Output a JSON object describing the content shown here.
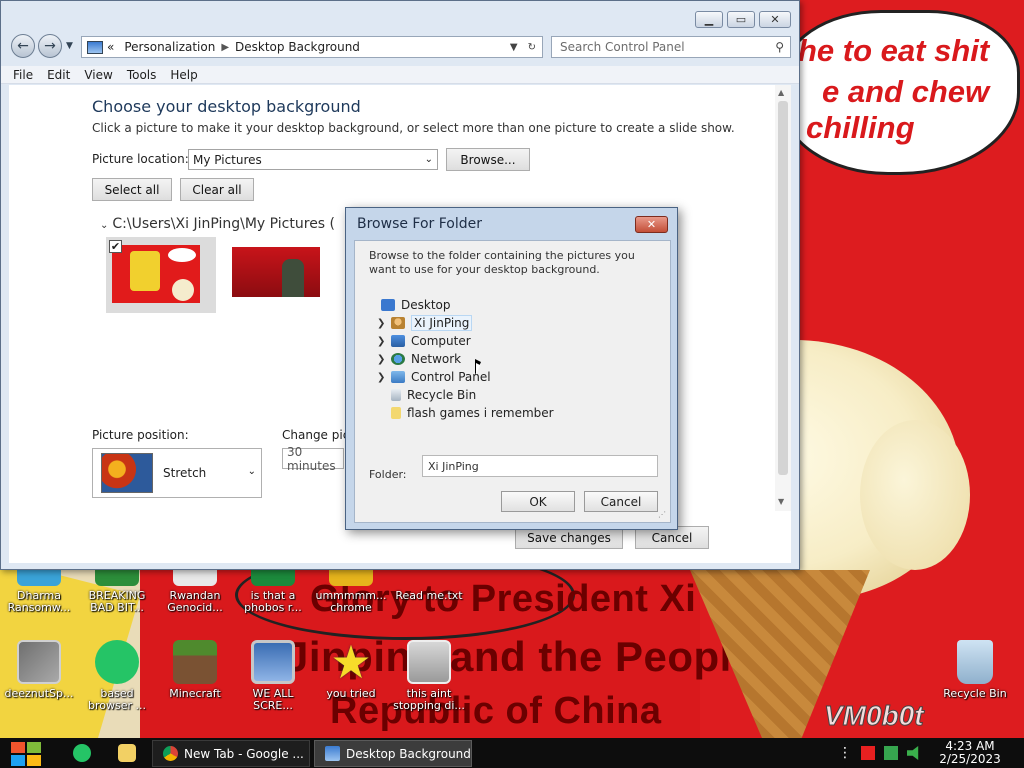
{
  "wallpaper": {
    "speech_lines": [
      "he to eat shit",
      "e and chew",
      "chilling"
    ],
    "slogan_lines": [
      "Glory to President Xi",
      "Jinping and the People's",
      "Republic of China"
    ],
    "watermark": "VM0b0t"
  },
  "desktop_icons": {
    "top_row": [
      "Dharma Ransomw...",
      "BREAKING BAD BIT...",
      "Rwandan Genocid...",
      "is that a phobos r...",
      "ummmmm... chrome",
      "Read me.txt"
    ],
    "bottom_row": [
      "deeznutSp...",
      "based browser ...",
      "Minecraft",
      "WE ALL SCRE...",
      "you tried",
      "this aint stopping di..."
    ],
    "recycle_bin": "Recycle Bin"
  },
  "window": {
    "breadcrumb_root": "Personalization",
    "breadcrumb_current": "Desktop Background",
    "search_placeholder": "Search Control Panel",
    "menu": [
      "File",
      "Edit",
      "View",
      "Tools",
      "Help"
    ],
    "heading": "Choose your desktop background",
    "subheading": "Click a picture to make it your desktop background, or select more than one picture to create a slide show.",
    "picture_location_label": "Picture location:",
    "picture_location_value": "My Pictures",
    "browse_label": "Browse...",
    "select_all_label": "Select all",
    "clear_all_label": "Clear all",
    "folder_path": "C:\\Users\\Xi JinPing\\My Pictures (",
    "picture_position_label": "Picture position:",
    "picture_position_value": "Stretch",
    "change_picture_label": "Change pict",
    "interval_value": "30 minutes",
    "save_label": "Save changes",
    "cancel_label": "Cancel"
  },
  "dialog": {
    "title": "Browse For Folder",
    "description": "Browse to the folder containing the pictures you want to use for your desktop background.",
    "tree": [
      "Desktop",
      "Xi JinPing",
      "Computer",
      "Network",
      "Control Panel",
      "Recycle Bin",
      "flash games i remember"
    ],
    "folder_label": "Folder:",
    "folder_value": "Xi JinPing",
    "ok_label": "OK",
    "cancel_label": "Cancel"
  },
  "taskbar": {
    "task_chrome": "New Tab - Google ...",
    "task_cp": "Desktop Background",
    "time": "4:23 AM",
    "date": "2/25/2023"
  }
}
